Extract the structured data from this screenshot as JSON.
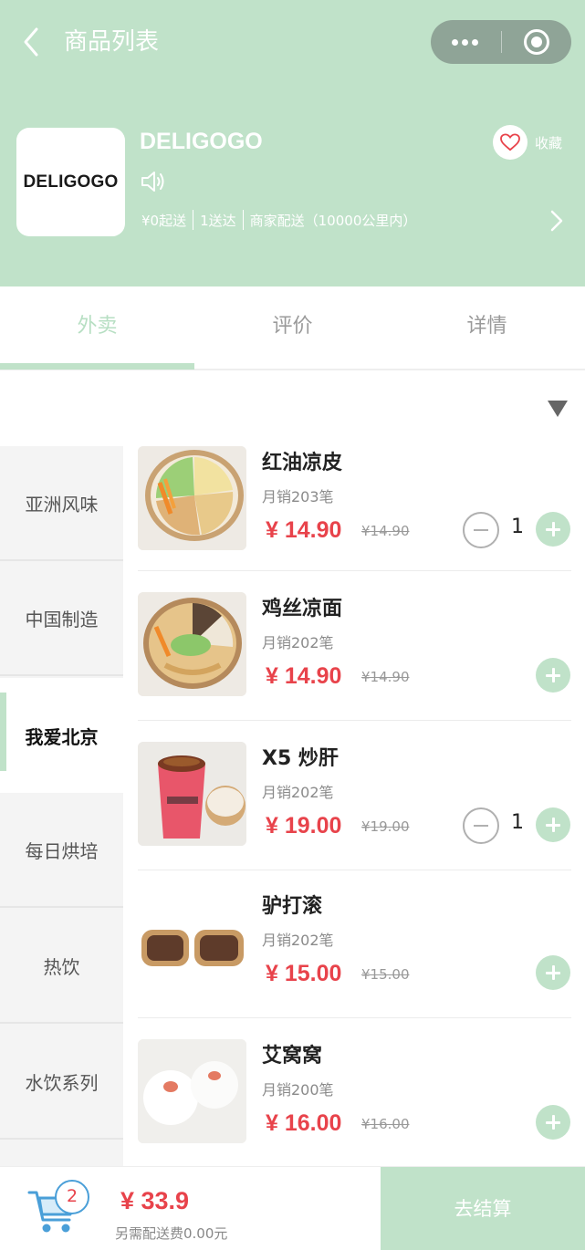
{
  "nav": {
    "title": "商品列表",
    "back_icon": "chevron-left-icon",
    "more_icon": "more-dots-icon",
    "close_icon": "target-circle-icon"
  },
  "shop": {
    "logo_text": "DELIGOGO",
    "name": "DELIGOGO",
    "speaker_icon": "speaker-icon",
    "min_order": "¥0起送",
    "delivery_time": "1送达",
    "delivery_info": "商家配送（10000公里内）",
    "favorite_label": "收藏",
    "favorite_icon": "heart-icon"
  },
  "tabs": [
    "外卖",
    "评价",
    "详情"
  ],
  "active_tab": "外卖",
  "sort_icon": "triangle-down-icon",
  "categories": [
    "亚洲风味",
    "中国制造",
    "我爱北京",
    "每日烘培",
    "热饮",
    "水饮系列"
  ],
  "active_category": "我爱北京",
  "products": [
    {
      "name": "红油凉皮",
      "sales": "月销203笔",
      "price": "¥ 14.90",
      "original_price": "¥14.90",
      "quantity": "1",
      "image": "liangpi-bowl"
    },
    {
      "name": "鸡丝凉面",
      "sales": "月销202笔",
      "price": "¥ 14.90",
      "original_price": "¥14.90",
      "quantity": "",
      "image": "noodle-bowl"
    },
    {
      "name": "X5 炒肝",
      "sales": "月销202笔",
      "price": "¥ 19.00",
      "original_price": "¥19.00",
      "quantity": "1",
      "image": "chaogan-cup"
    },
    {
      "name": "驴打滚",
      "sales": "月销202笔",
      "price": "¥ 15.00",
      "original_price": "¥15.00",
      "quantity": "",
      "image": "lvdagun-roll"
    },
    {
      "name": "艾窝窝",
      "sales": "月销200笔",
      "price": "¥ 16.00",
      "original_price": "¥16.00",
      "quantity": "",
      "image": "aiwowo-buns"
    }
  ],
  "cart": {
    "count": "2",
    "total": "¥ 33.9",
    "delivery_fee": "另需配送费0.00元",
    "checkout_label": "去结算",
    "cart_icon": "cart-icon"
  },
  "colors": {
    "brand_green": "#c0e2c9",
    "price_red": "#e8434b",
    "capsule_gray": "#8fa497"
  }
}
